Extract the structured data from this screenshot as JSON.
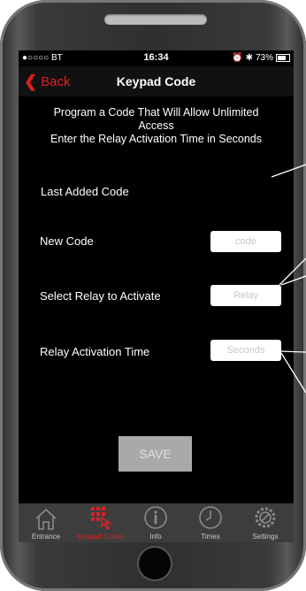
{
  "status": {
    "carrier": "●○○○○ BT",
    "time": "16:34",
    "battery": "73%"
  },
  "nav": {
    "back_label": "Back",
    "title": "Keypad Code"
  },
  "instructions": {
    "line1": "Program a Code That Will Allow Unlimited",
    "line2": "Access",
    "line3": "Enter the Relay Activation Time in Seconds"
  },
  "form": {
    "last_added_label": "Last Added Code",
    "new_code_label": "New Code",
    "new_code_placeholder": "code",
    "relay_label": "Select Relay to Activate",
    "relay_placeholder": "Relay",
    "time_label": "Relay Activation Time",
    "time_placeholder": "Seconds"
  },
  "save_label": "SAVE",
  "tabs": [
    {
      "label": "Entrance",
      "icon": "house-icon"
    },
    {
      "label": "Keypad Codes",
      "icon": "keypad-icon",
      "active": true
    },
    {
      "label": "Info",
      "icon": "info-icon"
    },
    {
      "label": "Times",
      "icon": "clock-icon"
    },
    {
      "label": "Settings",
      "icon": "gear-icon"
    }
  ],
  "colors": {
    "accent": "#e02020",
    "background": "#000000",
    "tabbar": "#3d3d3d"
  }
}
